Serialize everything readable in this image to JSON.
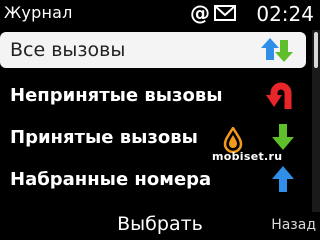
{
  "status": {
    "title": "Журнал",
    "at_symbol": "@",
    "time": "02:24"
  },
  "menu": {
    "items": [
      {
        "label": "Все вызовы",
        "icon": "all-calls-icon",
        "selected": true
      },
      {
        "label": "Непринятые вызовы",
        "icon": "missed-calls-icon",
        "selected": false
      },
      {
        "label": "Принятые вызовы",
        "icon": "received-calls-icon",
        "selected": false
      },
      {
        "label": "Набранные номера",
        "icon": "dialled-numbers-icon",
        "selected": false
      }
    ]
  },
  "softkeys": {
    "select": "Выбрать",
    "back": "Назад"
  },
  "watermark": "mobiset.ru",
  "colors": {
    "green_arrow": "#5fbf2a",
    "blue_arrow": "#2f8ee8",
    "red_arrow": "#e8262a",
    "selected_bg": "#f4f4f4"
  }
}
